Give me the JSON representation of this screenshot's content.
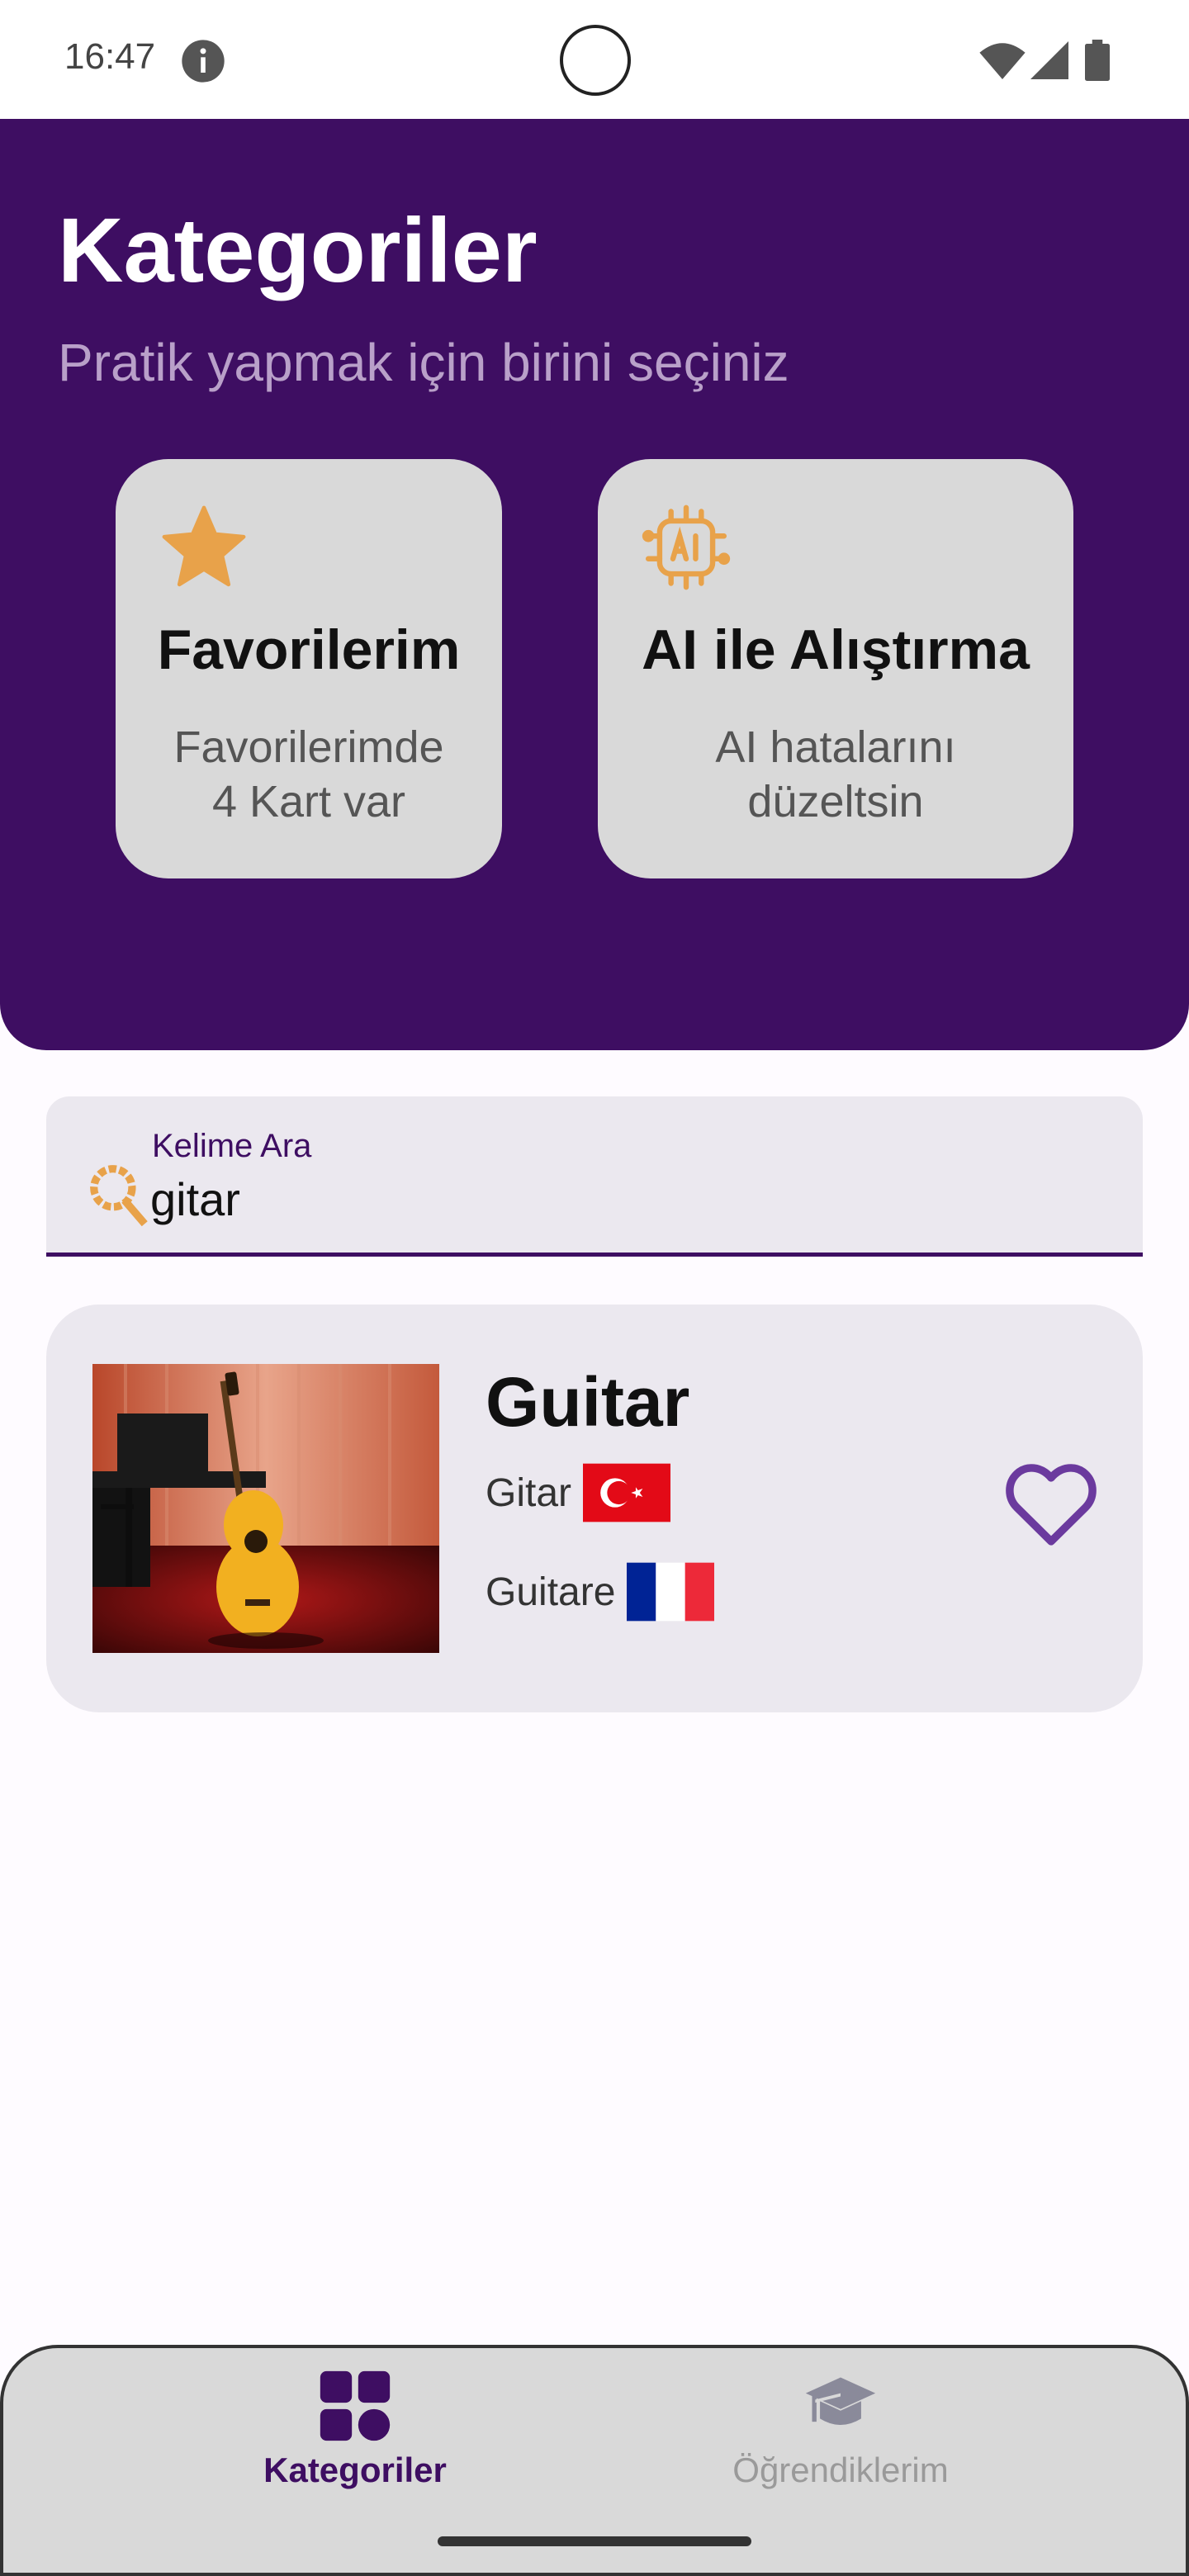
{
  "status_bar": {
    "time": "16:47",
    "icons": [
      "info-icon",
      "wifi-icon",
      "signal-icon",
      "battery-icon"
    ]
  },
  "header": {
    "title": "Kategoriler",
    "subtitle": "Pratik yapmak için birini seçiniz",
    "background_color": "#3e0e62"
  },
  "cards": {
    "favorites": {
      "icon": "star-icon",
      "title": "Favorilerim",
      "desc_line1": "Favorilerimde",
      "desc_line2": "4 Kart var"
    },
    "ai": {
      "icon": "ai-chip-icon",
      "title": "AI ile Alıştırma",
      "desc_line1": "AI hatalarını",
      "desc_line2": "düzeltsin"
    }
  },
  "search": {
    "label": "Kelime Ara",
    "value": "gitar",
    "icon": "search-icon"
  },
  "results": [
    {
      "title": "Guitar",
      "image": "guitar-photo",
      "translations": [
        {
          "word": "Gitar",
          "flag": "turkey-flag-icon"
        },
        {
          "word": "Guitare",
          "flag": "france-flag-icon"
        }
      ],
      "favorite_icon": "heart-outline-icon"
    }
  ],
  "bottom_nav": {
    "items": [
      {
        "label": "Kategoriler",
        "icon": "grid-icon",
        "active": true
      },
      {
        "label": "Öğrendiklerim",
        "icon": "graduation-cap-icon",
        "active": false
      }
    ]
  },
  "colors": {
    "accent": "#3e0e62",
    "icon_orange": "#e8a24a",
    "heart": "#6b3a9e"
  }
}
